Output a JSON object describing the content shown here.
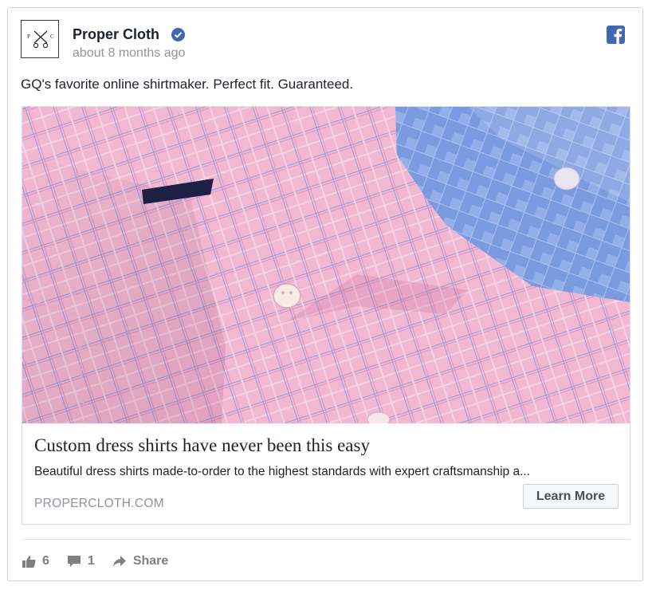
{
  "post": {
    "page_name": "Proper Cloth",
    "verified_icon": "verified-badge-icon",
    "timestamp": "about 8 months ago",
    "text": "GQ's favorite online shirtmaker. Perfect fit. Guaranteed.",
    "avatar": {
      "left_letter": "P",
      "right_letter": "C",
      "icon": "crossed-scissors-icon"
    },
    "network_icon": "facebook-icon"
  },
  "attachment": {
    "image_alt": "Pink plaid and blue check dress shirts",
    "title": "Custom dress shirts have never been this easy",
    "description": "Beautiful dress shirts made-to-order to the highest standards with expert craftsmanship a...",
    "domain": "PROPERCLOTH.COM",
    "cta_label": "Learn More"
  },
  "reactions": {
    "likes": "6",
    "comments": "1",
    "share_label": "Share"
  },
  "colors": {
    "facebook_blue": "#4267b2",
    "meta_gray": "#90949c",
    "shirt_pink": "#f0b4cf",
    "shirt_blue": "#7e9ce0"
  }
}
